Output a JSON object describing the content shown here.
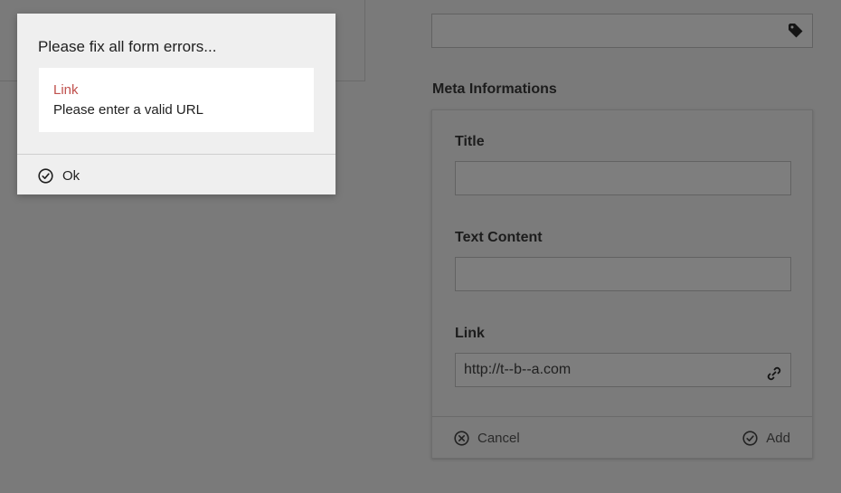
{
  "modal": {
    "title": "Please fix all form errors...",
    "errors": [
      {
        "field": "Link",
        "message": "Please enter a valid URL"
      }
    ],
    "ok_label": "Ok"
  },
  "meta": {
    "heading": "Meta Informations",
    "title_label": "Title",
    "title_value": "",
    "text_label": "Text Content",
    "text_value": "",
    "link_label": "Link",
    "link_value": "http://t--b--a.com",
    "cancel_label": "Cancel",
    "add_label": "Add"
  },
  "icons": {
    "tag": "tag-icon",
    "link": "link-icon",
    "cancel": "cancel-circle-icon",
    "add": "check-circle-icon",
    "ok": "check-circle-icon"
  },
  "colors": {
    "error_text": "#c0504d",
    "overlay": "#7a7a7a",
    "modal_bg": "#efefef"
  }
}
